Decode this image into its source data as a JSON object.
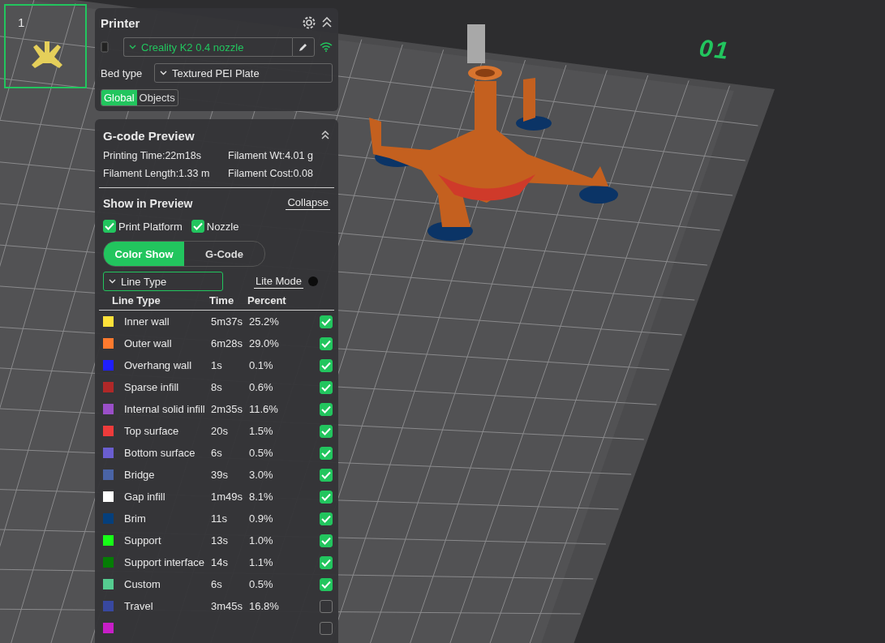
{
  "plate_thumbnail": {
    "number": "1",
    "selected": true
  },
  "bed_label": "01",
  "printer": {
    "title": "Printer",
    "preset": "Creality K2 0.4 nozzle",
    "bed_type_label": "Bed type",
    "bed_type": "Textured PEI Plate",
    "scope_tabs": [
      {
        "label": "Global",
        "selected": true
      },
      {
        "label": "Objects",
        "selected": false
      }
    ]
  },
  "gcode_preview": {
    "title": "G-code Preview",
    "stats": [
      "Printing Time:22m18s",
      "Filament Wt:4.01 g",
      "Filament Length:1.33 m",
      "Filament Cost:0.08"
    ],
    "show_title": "Show in Preview",
    "collapse": "Collapse",
    "options": [
      {
        "label": "Print Platform",
        "checked": true
      },
      {
        "label": "Nozzle",
        "checked": true
      }
    ],
    "view_tabs": [
      {
        "label": "Color Show",
        "selected": true
      },
      {
        "label": "G-Code",
        "selected": false
      }
    ],
    "view_select": "Line Type",
    "lite_mode": {
      "label": "Lite Mode",
      "on": false
    },
    "table": {
      "columns": [
        "Line Type",
        "Time",
        "Percent"
      ],
      "rows": [
        {
          "name": "Inner wall",
          "time": "5m37s",
          "percent": "25.2%",
          "color": "#ffe23a",
          "checked": true
        },
        {
          "name": "Outer wall",
          "time": "6m28s",
          "percent": "29.0%",
          "color": "#ff7a2e",
          "checked": true
        },
        {
          "name": "Overhang wall",
          "time": "1s",
          "percent": "0.1%",
          "color": "#1f1fff",
          "checked": true
        },
        {
          "name": "Sparse infill",
          "time": "8s",
          "percent": "0.6%",
          "color": "#b02828",
          "checked": true
        },
        {
          "name": "Internal solid infill",
          "time": "2m35s",
          "percent": "11.6%",
          "color": "#9a4fc8",
          "checked": true
        },
        {
          "name": "Top surface",
          "time": "20s",
          "percent": "1.5%",
          "color": "#ee3b3b",
          "checked": true
        },
        {
          "name": "Bottom surface",
          "time": "6s",
          "percent": "0.5%",
          "color": "#6a5ed0",
          "checked": true
        },
        {
          "name": "Bridge",
          "time": "39s",
          "percent": "3.0%",
          "color": "#4a64a6",
          "checked": true
        },
        {
          "name": "Gap infill",
          "time": "1m49s",
          "percent": "8.1%",
          "color": "#ffffff",
          "checked": true
        },
        {
          "name": "Brim",
          "time": "11s",
          "percent": "0.9%",
          "color": "#053f7c",
          "checked": true
        },
        {
          "name": "Support",
          "time": "13s",
          "percent": "1.0%",
          "color": "#17ff17",
          "checked": true
        },
        {
          "name": "Support interface",
          "time": "14s",
          "percent": "1.1%",
          "color": "#057d05",
          "checked": true
        },
        {
          "name": "Custom",
          "time": "6s",
          "percent": "0.5%",
          "color": "#55cc90",
          "checked": true
        },
        {
          "name": "Travel",
          "time": "3m45s",
          "percent": "16.8%",
          "color": "#3848a0",
          "checked": false
        },
        {
          "color": "#c81ec8",
          "checked": false
        }
      ]
    }
  }
}
